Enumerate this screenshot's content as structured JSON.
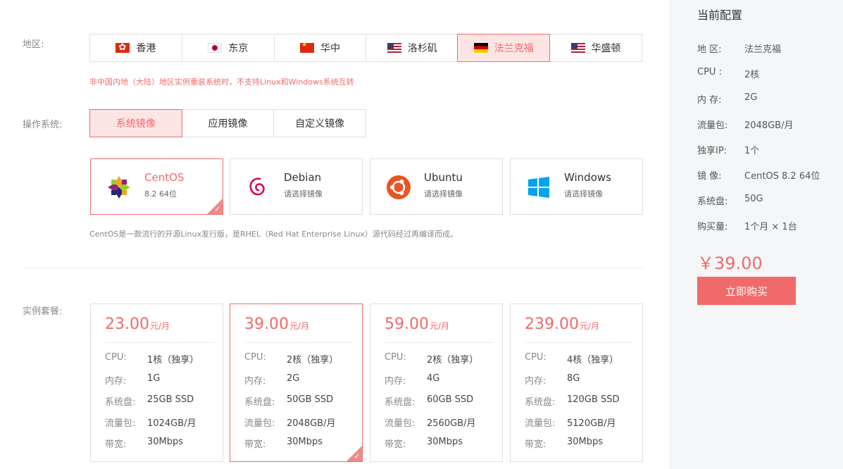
{
  "region": {
    "label": "地区:",
    "tabs": [
      {
        "label": "香港",
        "flag": "hk-flag-icon"
      },
      {
        "label": "东京",
        "flag": "jp-flag-icon"
      },
      {
        "label": "华中",
        "flag": "cn-flag-icon"
      },
      {
        "label": "洛杉矶",
        "flag": "us-flag-icon"
      },
      {
        "label": "法兰克福",
        "flag": "de-flag-icon"
      },
      {
        "label": "华盛顿",
        "flag": "us-flag-icon"
      }
    ],
    "selected": "法兰克福",
    "note": "非中国内地（大陆）地区实例重装系统时，不支持Linux和Windows系统互转"
  },
  "os": {
    "label": "操作系统:",
    "tabs": [
      {
        "label": "系统镜像"
      },
      {
        "label": "应用镜像"
      },
      {
        "label": "自定义镜像"
      }
    ],
    "cards": [
      {
        "name": "CentOS",
        "sub": "8.2 64位",
        "icon": "centos-logo-icon"
      },
      {
        "name": "Debian",
        "sub": "请选择镜像",
        "icon": "debian-logo-icon"
      },
      {
        "name": "Ubuntu",
        "sub": "请选择镜像",
        "icon": "ubuntu-logo-icon"
      },
      {
        "name": "Windows",
        "sub": "请选择镜像",
        "icon": "windows-logo-icon"
      }
    ],
    "description": "CentOS是一款流行的开源Linux发行版，是RHEL（Red Hat Enterprise Linux）源代码经过再编译而成。"
  },
  "plans": {
    "label": "实例套餐:",
    "items": [
      {
        "price": "23.00",
        "unit": "元/月",
        "specs": [
          {
            "k": "CPU:",
            "v": "1核（独享）"
          },
          {
            "k": "内存:",
            "v": "1G"
          },
          {
            "k": "系统盘:",
            "v": "25GB SSD"
          },
          {
            "k": "流量包:",
            "v": "1024GB/月"
          },
          {
            "k": "带宽:",
            "v": "30Mbps"
          }
        ]
      },
      {
        "price": "39.00",
        "unit": "元/月",
        "specs": [
          {
            "k": "CPU:",
            "v": "2核（独享）"
          },
          {
            "k": "内存:",
            "v": "2G"
          },
          {
            "k": "系统盘:",
            "v": "50GB SSD"
          },
          {
            "k": "流量包:",
            "v": "2048GB/月"
          },
          {
            "k": "带宽:",
            "v": "30Mbps"
          }
        ]
      },
      {
        "price": "59.00",
        "unit": "元/月",
        "specs": [
          {
            "k": "CPU:",
            "v": "2核（独享）"
          },
          {
            "k": "内存:",
            "v": "4G"
          },
          {
            "k": "系统盘:",
            "v": "60GB SSD"
          },
          {
            "k": "流量包:",
            "v": "2560GB/月"
          },
          {
            "k": "带宽:",
            "v": "30Mbps"
          }
        ]
      },
      {
        "price": "239.00",
        "unit": "元/月",
        "specs": [
          {
            "k": "CPU:",
            "v": "4核（独享）"
          },
          {
            "k": "内存:",
            "v": "8G"
          },
          {
            "k": "系统盘:",
            "v": "120GB SSD"
          },
          {
            "k": "流量包:",
            "v": "5120GB/月"
          },
          {
            "k": "带宽:",
            "v": "30Mbps"
          }
        ]
      }
    ]
  },
  "summary": {
    "title": "当前配置",
    "rows": [
      {
        "k": "地 区:",
        "v": "法兰克福"
      },
      {
        "k": "CPU  :",
        "v": " 2核"
      },
      {
        "k": "内   存:",
        "v": "2G"
      },
      {
        "k": "流量包:",
        "v": "2048GB/月"
      },
      {
        "k": "独享IP:",
        "v": "1个"
      },
      {
        "k": "镜   像:",
        "v": "CentOS 8.2 64位"
      },
      {
        "k": "系统盘:",
        "v": "50G"
      },
      {
        "k": "购买量:",
        "v": " 1个月 × 1台"
      }
    ],
    "price": "￥39.00",
    "buy_label": "立即购买"
  },
  "colors": {
    "accent": "#f06a6a",
    "accent_bg": "#fde5e4",
    "sidebar_bg": "#f4f6f8"
  }
}
